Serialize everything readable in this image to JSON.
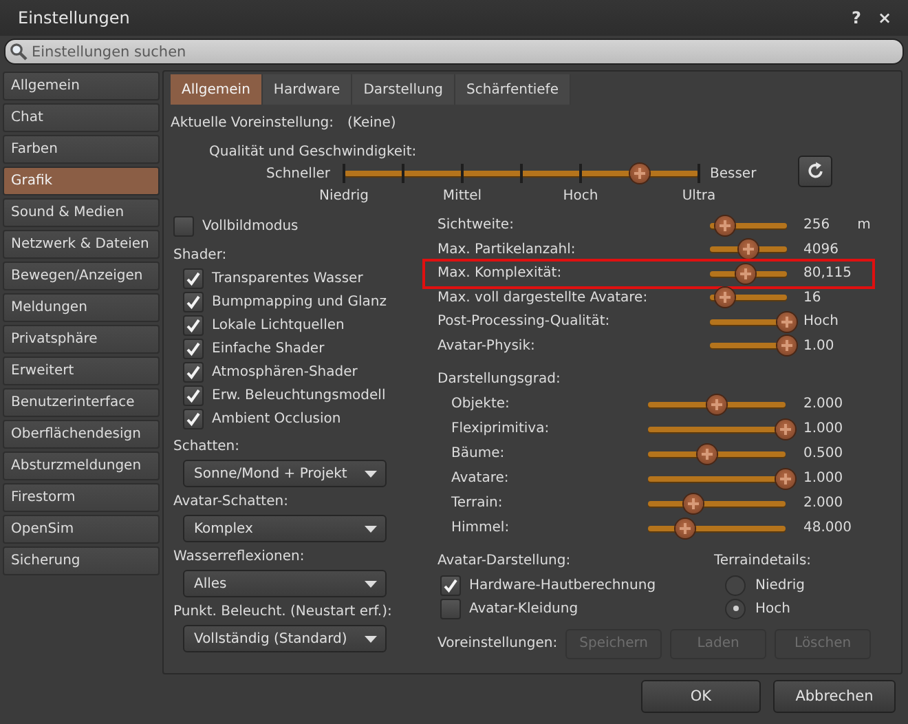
{
  "window": {
    "title": "Einstellungen",
    "help": "?",
    "close": "×"
  },
  "search": {
    "placeholder": "Einstellungen suchen"
  },
  "sidebar": {
    "items": [
      {
        "label": "Allgemein",
        "selected": false
      },
      {
        "label": "Chat",
        "selected": false
      },
      {
        "label": "Farben",
        "selected": false
      },
      {
        "label": "Grafik",
        "selected": true
      },
      {
        "label": "Sound & Medien",
        "selected": false
      },
      {
        "label": "Netzwerk & Dateien",
        "selected": false
      },
      {
        "label": "Bewegen/Anzeigen",
        "selected": false
      },
      {
        "label": "Meldungen",
        "selected": false
      },
      {
        "label": "Privatsphäre",
        "selected": false
      },
      {
        "label": "Erweitert",
        "selected": false
      },
      {
        "label": "Benutzerinterface",
        "selected": false
      },
      {
        "label": "Oberflächendesign",
        "selected": false
      },
      {
        "label": "Absturzmeldungen",
        "selected": false
      },
      {
        "label": "Firestorm",
        "selected": false
      },
      {
        "label": "OpenSim",
        "selected": false
      },
      {
        "label": "Sicherung",
        "selected": false
      }
    ]
  },
  "tabs": [
    {
      "label": "Allgemein",
      "selected": true
    },
    {
      "label": "Hardware",
      "selected": false
    },
    {
      "label": "Darstellung",
      "selected": false
    },
    {
      "label": "Schärfentiefe",
      "selected": false
    }
  ],
  "preset": {
    "label": "Aktuelle Voreinstellung:",
    "value": "(Keine)"
  },
  "quality": {
    "label": "Qualität und Geschwindigkeit:",
    "low_label": "Schneller",
    "high_label": "Besser",
    "level": 0.833,
    "ticks": [
      "Niedrig",
      "Mittel",
      "Hoch",
      "Ultra"
    ]
  },
  "fullscreen": {
    "label": "Vollbildmodus",
    "checked": false
  },
  "shaders": {
    "label": "Shader:",
    "items": [
      {
        "label": "Transparentes Wasser",
        "checked": true
      },
      {
        "label": "Bumpmapping und Glanz",
        "checked": true
      },
      {
        "label": "Lokale Lichtquellen",
        "checked": true
      },
      {
        "label": "Einfache Shader",
        "checked": true
      },
      {
        "label": "Atmosphären-Shader",
        "checked": true
      },
      {
        "label": "Erw. Beleuchtungsmodell",
        "checked": true
      },
      {
        "label": "Ambient Occlusion",
        "checked": true
      }
    ]
  },
  "dropdowns": [
    {
      "label": "Schatten:",
      "value": "Sonne/Mond + Projekt"
    },
    {
      "label": "Avatar-Schatten:",
      "value": "Komplex"
    },
    {
      "label": "Wasserreflexionen:",
      "value": "Alles"
    },
    {
      "label": "Punkt. Beleucht. (Neustart erf.):",
      "value": "Vollständig (Standard)"
    }
  ],
  "view_settings": [
    {
      "label": "Sichtweite:",
      "level": 0.2,
      "reading": "256",
      "unit": "m",
      "highlighted": false
    },
    {
      "label": "Max. Partikelanzahl:",
      "level": 0.5,
      "reading": "4096",
      "highlighted": false
    },
    {
      "label": "Max. Komplexität:",
      "level": 0.46,
      "reading": "80,115",
      "highlighted": true
    },
    {
      "label": "Max. voll dargestellte Avatare:",
      "level": 0.2,
      "reading": "16",
      "highlighted": false
    },
    {
      "label": "Post-Processing-Qualität:",
      "level": 1,
      "reading": "Hoch",
      "highlighted": false
    },
    {
      "label": "Avatar-Physik:",
      "level": 1,
      "reading": "1.00",
      "highlighted": false
    }
  ],
  "detail": {
    "label": "Darstellungsgrad:",
    "sliders": [
      {
        "label": "Objekte:",
        "level": 0.5,
        "reading": "2.000"
      },
      {
        "label": "Flexiprimitiva:",
        "level": 1,
        "reading": "1.000"
      },
      {
        "label": "Bäume:",
        "level": 0.43,
        "reading": "0.500"
      },
      {
        "label": "Avatare:",
        "level": 1,
        "reading": "1.000"
      },
      {
        "label": "Terrain:",
        "level": 0.33,
        "reading": "2.000"
      },
      {
        "label": "Himmel:",
        "level": 0.27,
        "reading": "48.000"
      }
    ]
  },
  "avatar_rendering": {
    "label": "Avatar-Darstellung:",
    "items": [
      {
        "label": "Hardware-Hautberechnung",
        "checked": true
      },
      {
        "label": "Avatar-Kleidung",
        "checked": false
      }
    ]
  },
  "terrain_detail": {
    "label": "Terraindetails:",
    "options": [
      {
        "label": "Niedrig",
        "selected": false
      },
      {
        "label": "Hoch",
        "selected": true
      }
    ]
  },
  "presets": {
    "label": "Voreinstellungen:",
    "buttons": [
      {
        "label": "Speichern",
        "disabled": true
      },
      {
        "label": "Laden",
        "disabled": true
      },
      {
        "label": "Löschen",
        "disabled": true
      }
    ]
  },
  "buttons": [
    {
      "label": "OK"
    },
    {
      "label": "Abbrechen"
    }
  ]
}
